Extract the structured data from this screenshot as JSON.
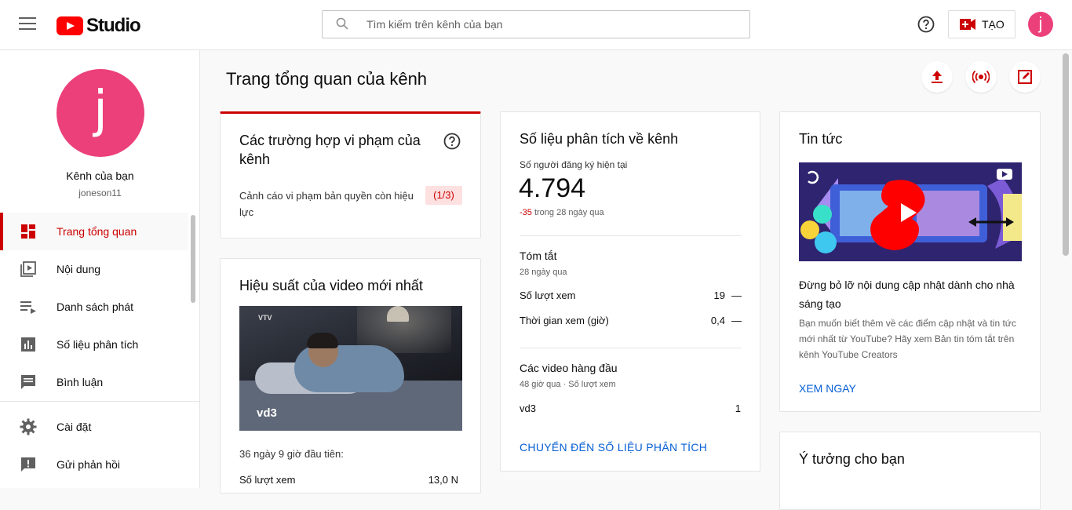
{
  "topbar": {
    "logo_text": "Studio",
    "search_placeholder": "Tìm kiếm trên kênh của bạn",
    "create_label": "TẠO",
    "avatar_letter": "j"
  },
  "sidebar": {
    "avatar_letter": "j",
    "channel_name": "Kênh của bạn",
    "channel_handle": "joneson11",
    "items": [
      {
        "label": "Trang tổng quan",
        "icon": "dashboard-icon",
        "active": true
      },
      {
        "label": "Nội dung",
        "icon": "content-icon",
        "active": false
      },
      {
        "label": "Danh sách phát",
        "icon": "playlist-icon",
        "active": false
      },
      {
        "label": "Số liệu phân tích",
        "icon": "analytics-icon",
        "active": false
      },
      {
        "label": "Bình luận",
        "icon": "comments-icon",
        "active": false
      },
      {
        "label": "Cài đặt",
        "icon": "gear-icon",
        "active": false
      },
      {
        "label": "Gửi phản hồi",
        "icon": "feedback-icon",
        "active": false
      }
    ]
  },
  "main": {
    "page_title": "Trang tổng quan của kênh",
    "violations": {
      "title": "Các trường hợp vi phạm của kênh",
      "strike_text": "Cảnh cáo vi phạm bản quyền còn hiệu lực",
      "strike_badge": "(1/3)"
    },
    "latest_video": {
      "title": "Hiệu suất của video mới nhất",
      "thumb_logo": "VTV",
      "video_name": "vd3",
      "since": "36 ngày 9 giờ đầu tiên:",
      "views_label": "Số lượt xem",
      "views_value": "13,0 N"
    },
    "analytics": {
      "title": "Số liệu phân tích về kênh",
      "subs_label": "Số người đăng ký hiện tại",
      "subs_value": "4.794",
      "delta_value": "-35",
      "delta_text": " trong 28 ngày qua",
      "summary_title": "Tóm tắt",
      "summary_period": "28 ngày qua",
      "views_label": "Số lượt xem",
      "views_value": "19",
      "watch_label": "Thời gian xem (giờ)",
      "watch_value": "0,4",
      "dash": "—",
      "top_title": "Các video hàng đầu",
      "top_sub": "48 giờ qua · Số lượt xem",
      "top_video": "vd3",
      "top_video_views": "1",
      "link": "CHUYỂN ĐẾN SỐ LIỆU PHÂN TÍCH"
    },
    "news": {
      "title": "Tin tức",
      "headline": "Đừng bỏ lỡ nội dung cập nhật dành cho nhà sáng tạo",
      "body": "Bạn muốn biết thêm về các điểm cập nhật và tin tức mới nhất từ YouTube? Hãy xem Bản tin tóm tắt trên kênh YouTube Creators",
      "link": "XEM NGAY"
    },
    "ideas": {
      "title": "Ý tưởng cho bạn"
    }
  },
  "colors": {
    "brand_red": "#ff0000",
    "accent_red": "#cc0000",
    "avatar_pink": "#ec407a",
    "link_blue": "#065fd4"
  }
}
